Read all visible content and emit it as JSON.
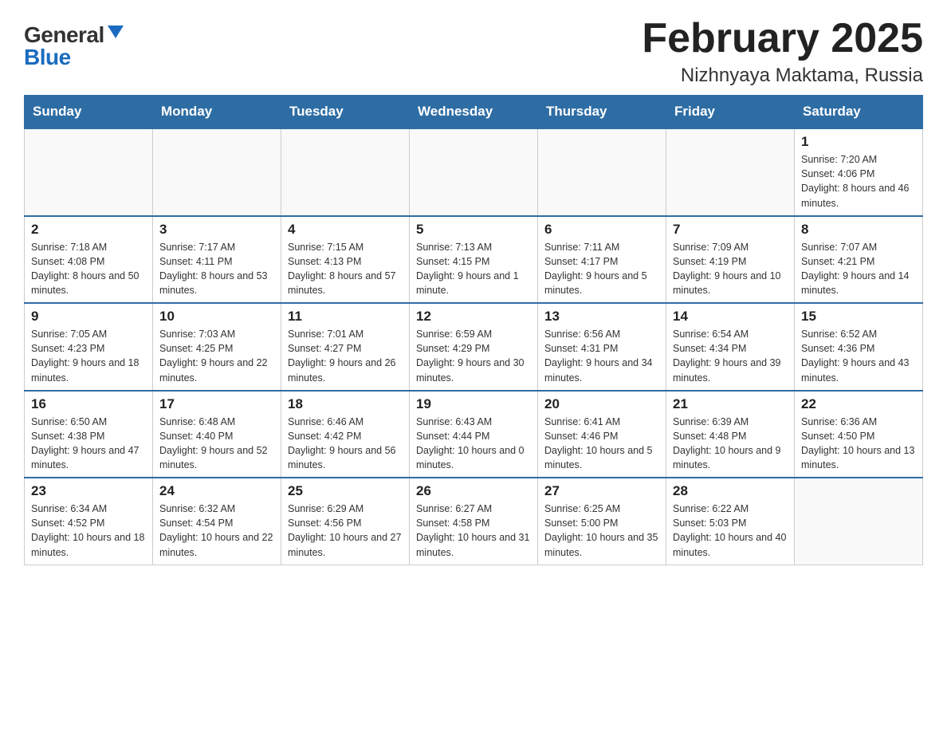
{
  "header": {
    "logo_general": "General",
    "logo_blue": "Blue",
    "month_title": "February 2025",
    "location": "Nizhnyaya Maktama, Russia"
  },
  "days_of_week": [
    "Sunday",
    "Monday",
    "Tuesday",
    "Wednesday",
    "Thursday",
    "Friday",
    "Saturday"
  ],
  "weeks": [
    [
      {
        "day": "",
        "info": ""
      },
      {
        "day": "",
        "info": ""
      },
      {
        "day": "",
        "info": ""
      },
      {
        "day": "",
        "info": ""
      },
      {
        "day": "",
        "info": ""
      },
      {
        "day": "",
        "info": ""
      },
      {
        "day": "1",
        "info": "Sunrise: 7:20 AM\nSunset: 4:06 PM\nDaylight: 8 hours and 46 minutes."
      }
    ],
    [
      {
        "day": "2",
        "info": "Sunrise: 7:18 AM\nSunset: 4:08 PM\nDaylight: 8 hours and 50 minutes."
      },
      {
        "day": "3",
        "info": "Sunrise: 7:17 AM\nSunset: 4:11 PM\nDaylight: 8 hours and 53 minutes."
      },
      {
        "day": "4",
        "info": "Sunrise: 7:15 AM\nSunset: 4:13 PM\nDaylight: 8 hours and 57 minutes."
      },
      {
        "day": "5",
        "info": "Sunrise: 7:13 AM\nSunset: 4:15 PM\nDaylight: 9 hours and 1 minute."
      },
      {
        "day": "6",
        "info": "Sunrise: 7:11 AM\nSunset: 4:17 PM\nDaylight: 9 hours and 5 minutes."
      },
      {
        "day": "7",
        "info": "Sunrise: 7:09 AM\nSunset: 4:19 PM\nDaylight: 9 hours and 10 minutes."
      },
      {
        "day": "8",
        "info": "Sunrise: 7:07 AM\nSunset: 4:21 PM\nDaylight: 9 hours and 14 minutes."
      }
    ],
    [
      {
        "day": "9",
        "info": "Sunrise: 7:05 AM\nSunset: 4:23 PM\nDaylight: 9 hours and 18 minutes."
      },
      {
        "day": "10",
        "info": "Sunrise: 7:03 AM\nSunset: 4:25 PM\nDaylight: 9 hours and 22 minutes."
      },
      {
        "day": "11",
        "info": "Sunrise: 7:01 AM\nSunset: 4:27 PM\nDaylight: 9 hours and 26 minutes."
      },
      {
        "day": "12",
        "info": "Sunrise: 6:59 AM\nSunset: 4:29 PM\nDaylight: 9 hours and 30 minutes."
      },
      {
        "day": "13",
        "info": "Sunrise: 6:56 AM\nSunset: 4:31 PM\nDaylight: 9 hours and 34 minutes."
      },
      {
        "day": "14",
        "info": "Sunrise: 6:54 AM\nSunset: 4:34 PM\nDaylight: 9 hours and 39 minutes."
      },
      {
        "day": "15",
        "info": "Sunrise: 6:52 AM\nSunset: 4:36 PM\nDaylight: 9 hours and 43 minutes."
      }
    ],
    [
      {
        "day": "16",
        "info": "Sunrise: 6:50 AM\nSunset: 4:38 PM\nDaylight: 9 hours and 47 minutes."
      },
      {
        "day": "17",
        "info": "Sunrise: 6:48 AM\nSunset: 4:40 PM\nDaylight: 9 hours and 52 minutes."
      },
      {
        "day": "18",
        "info": "Sunrise: 6:46 AM\nSunset: 4:42 PM\nDaylight: 9 hours and 56 minutes."
      },
      {
        "day": "19",
        "info": "Sunrise: 6:43 AM\nSunset: 4:44 PM\nDaylight: 10 hours and 0 minutes."
      },
      {
        "day": "20",
        "info": "Sunrise: 6:41 AM\nSunset: 4:46 PM\nDaylight: 10 hours and 5 minutes."
      },
      {
        "day": "21",
        "info": "Sunrise: 6:39 AM\nSunset: 4:48 PM\nDaylight: 10 hours and 9 minutes."
      },
      {
        "day": "22",
        "info": "Sunrise: 6:36 AM\nSunset: 4:50 PM\nDaylight: 10 hours and 13 minutes."
      }
    ],
    [
      {
        "day": "23",
        "info": "Sunrise: 6:34 AM\nSunset: 4:52 PM\nDaylight: 10 hours and 18 minutes."
      },
      {
        "day": "24",
        "info": "Sunrise: 6:32 AM\nSunset: 4:54 PM\nDaylight: 10 hours and 22 minutes."
      },
      {
        "day": "25",
        "info": "Sunrise: 6:29 AM\nSunset: 4:56 PM\nDaylight: 10 hours and 27 minutes."
      },
      {
        "day": "26",
        "info": "Sunrise: 6:27 AM\nSunset: 4:58 PM\nDaylight: 10 hours and 31 minutes."
      },
      {
        "day": "27",
        "info": "Sunrise: 6:25 AM\nSunset: 5:00 PM\nDaylight: 10 hours and 35 minutes."
      },
      {
        "day": "28",
        "info": "Sunrise: 6:22 AM\nSunset: 5:03 PM\nDaylight: 10 hours and 40 minutes."
      },
      {
        "day": "",
        "info": ""
      }
    ]
  ]
}
